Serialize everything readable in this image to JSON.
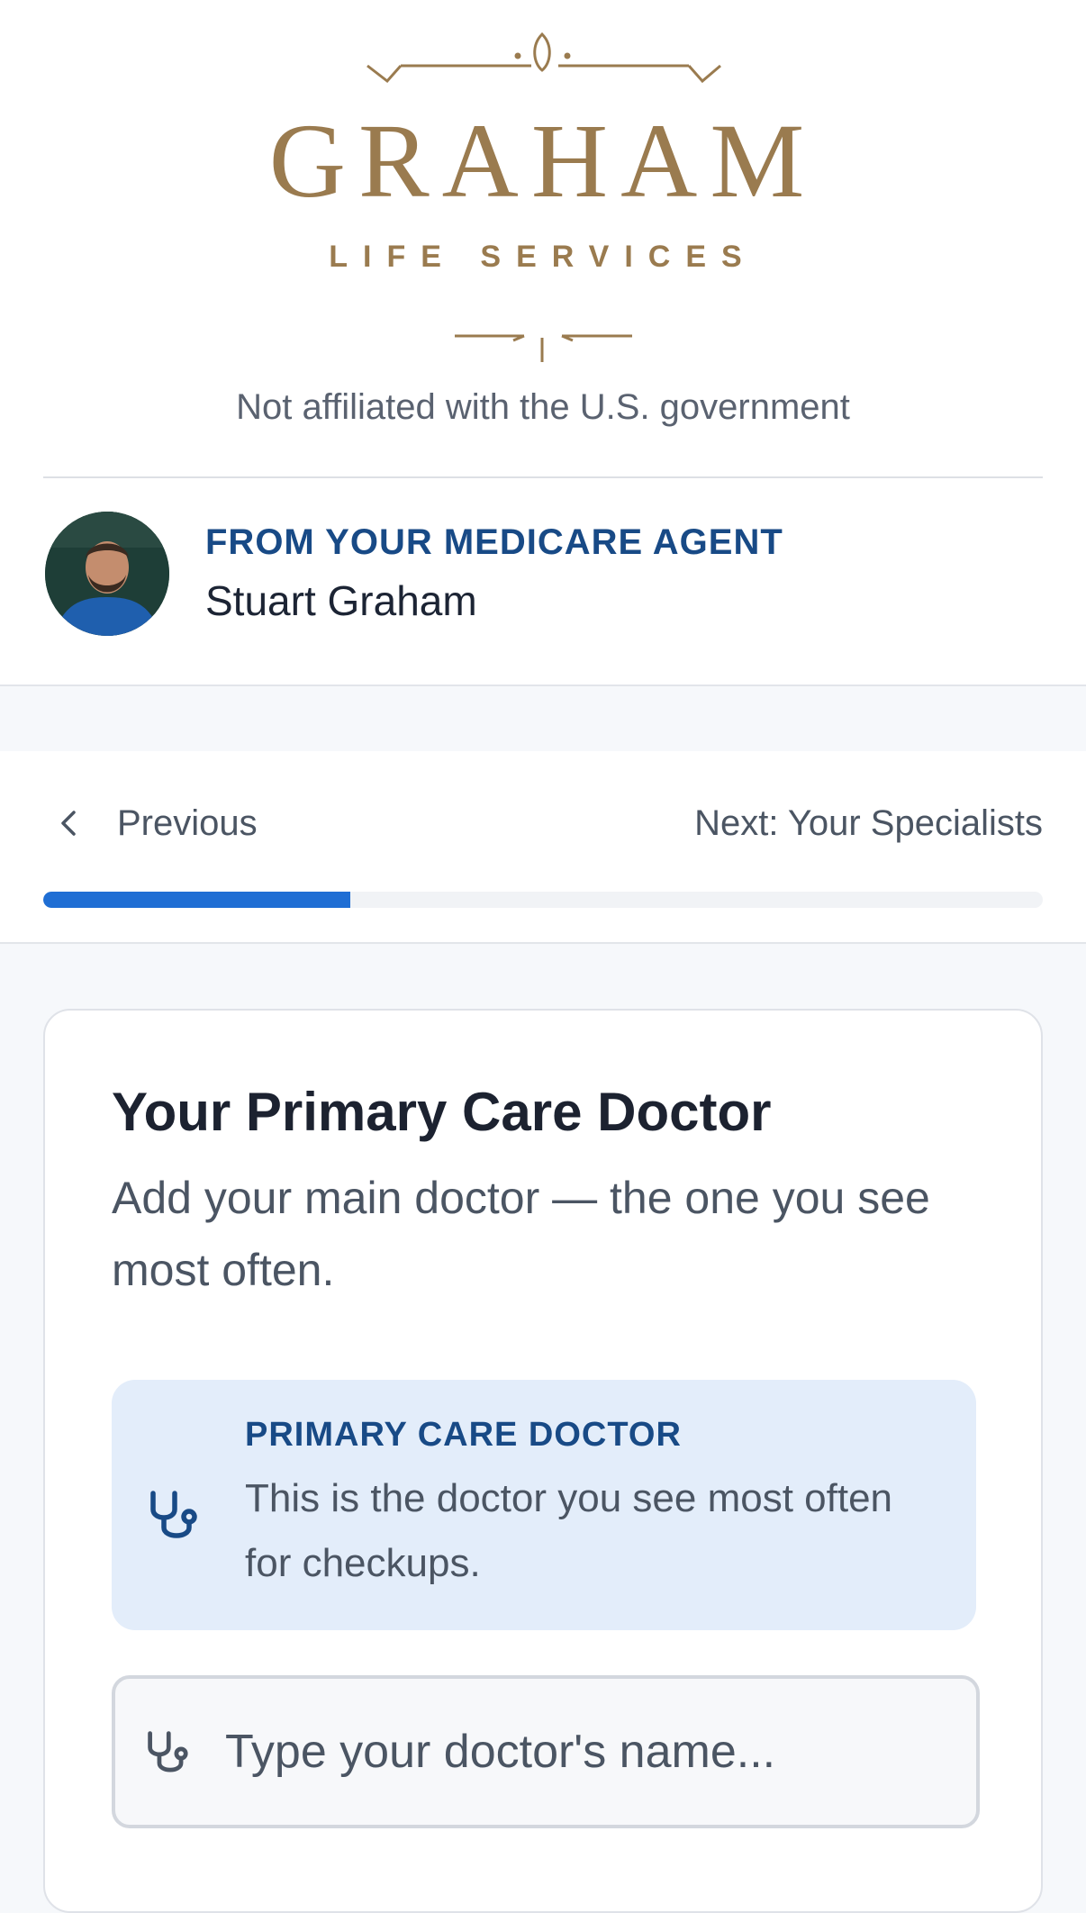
{
  "brand": {
    "logo_title": "GRAHAM",
    "logo_subtitle": "LIFE SERVICES",
    "accent_color": "#9a7b4f",
    "disclaimer": "Not affiliated with the U.S. government"
  },
  "agent": {
    "kicker": "FROM YOUR MEDICARE AGENT",
    "name": "Stuart Graham"
  },
  "navigation": {
    "previous_label": "Previous",
    "next_label": "Next: Your Specialists",
    "progress_fraction": 0.307,
    "progress_color": "#1f6ed4"
  },
  "card": {
    "title": "Your Primary Care Doctor",
    "description": "Add your main doctor — the one you see most often.",
    "info": {
      "kicker": "PRIMARY CARE DOCTOR",
      "text": "This is the doctor you see most often for checkups.",
      "icon": "stethoscope-icon"
    },
    "search": {
      "placeholder": "Type your doctor's name...",
      "value": "",
      "icon": "stethoscope-icon"
    }
  }
}
